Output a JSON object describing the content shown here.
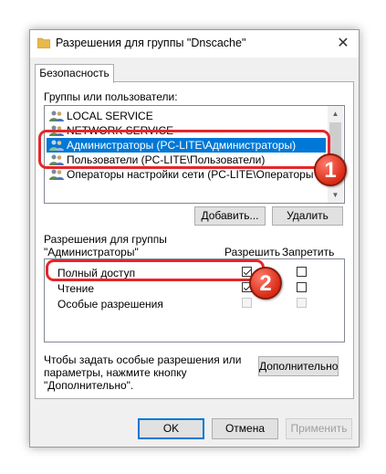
{
  "window": {
    "title": "Разрешения для группы \"Dnscache\"",
    "close_glyph": "✕"
  },
  "tab": {
    "label": "Безопасность"
  },
  "groups": {
    "label": "Группы или пользователи:",
    "items": [
      {
        "label": "LOCAL SERVICE",
        "selected": false
      },
      {
        "label": "NETWORK SERVICE",
        "selected": false
      },
      {
        "label": "Администраторы (PC-LITE\\Администраторы)",
        "selected": true
      },
      {
        "label": "Пользователи (PC-LITE\\Пользователи)",
        "selected": false
      },
      {
        "label": "Операторы настройки сети (PC-LITE\\Операторы наст",
        "selected": false
      }
    ],
    "add_button": "Добавить...",
    "remove_button": "Удалить"
  },
  "permissions": {
    "label_line1": "Разрешения для группы",
    "label_line2": "\"Администраторы\"",
    "allow_header": "Разрешить",
    "deny_header": "Запретить",
    "rows": [
      {
        "name": "Полный доступ",
        "allow": true,
        "deny": false,
        "disabled": false
      },
      {
        "name": "Чтение",
        "allow": true,
        "deny": false,
        "disabled": false
      },
      {
        "name": "Особые разрешения",
        "allow": false,
        "deny": false,
        "disabled": true
      }
    ]
  },
  "advanced": {
    "text_line1": "Чтобы задать особые разрешения или",
    "text_line2": "параметры, нажмите кнопку",
    "text_line3": "\"Дополнительно\".",
    "button": "Дополнительно"
  },
  "footer": {
    "ok": "OK",
    "cancel": "Отмена",
    "apply": "Применить"
  },
  "annotations": {
    "badge1": "1",
    "badge2": "2",
    "color": "#e5262b"
  },
  "colors": {
    "selection": "#0078d7",
    "window_bg": "#f0f0f0"
  }
}
